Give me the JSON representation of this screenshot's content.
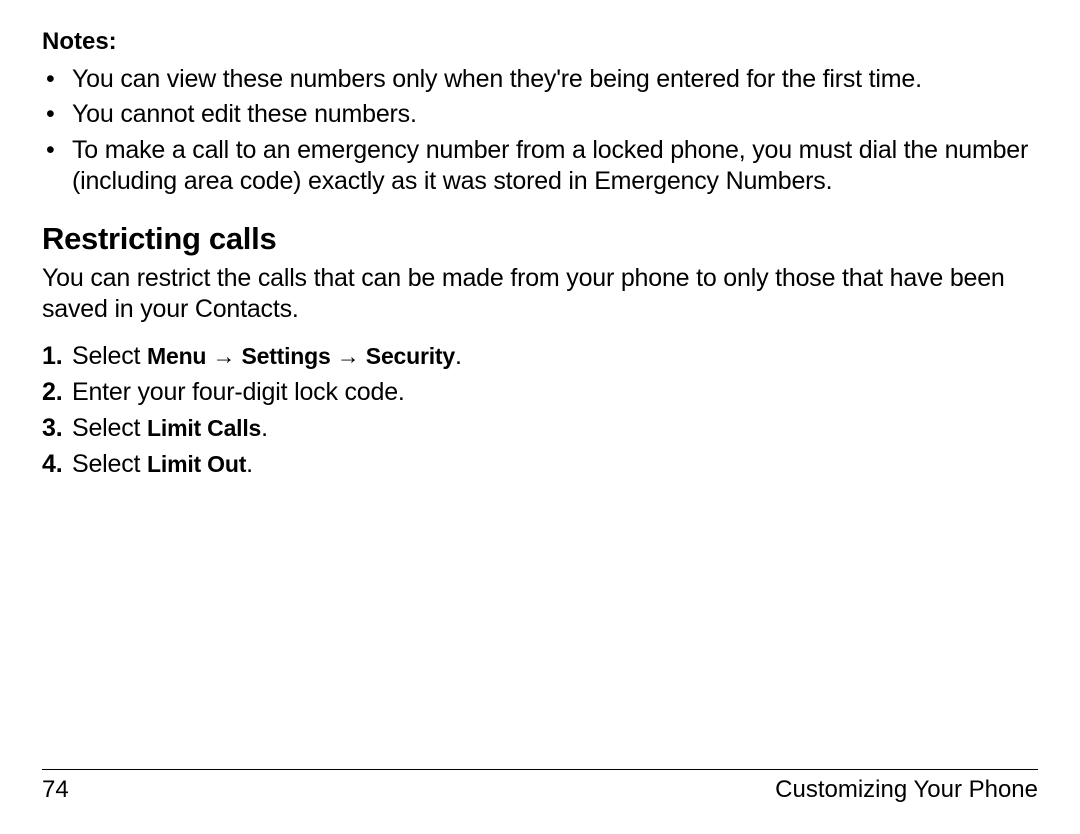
{
  "notes": {
    "heading": "Notes:",
    "items": [
      "You can view these numbers only when they're being entered for the first time.",
      "You cannot edit these numbers.",
      "To make a call to an emergency number from a locked phone, you must dial the number (including area code) exactly as it was stored in Emergency Numbers."
    ]
  },
  "section": {
    "heading": "Restricting calls",
    "intro": "You can restrict the calls that can be made from your phone to only those that have been saved in your Contacts."
  },
  "steps": {
    "step1_num": "1.",
    "step1_prefix": "Select ",
    "step1_menu": "Menu",
    "step1_arrow1": " → ",
    "step1_settings": "Settings",
    "step1_arrow2": " → ",
    "step1_security": "Security",
    "step1_suffix": ".",
    "step2_num": "2.",
    "step2_text": "Enter your four-digit lock code.",
    "step3_num": "3.",
    "step3_prefix": "Select ",
    "step3_bold": "Limit Calls",
    "step3_suffix": ".",
    "step4_num": "4.",
    "step4_prefix": "Select ",
    "step4_bold": "Limit Out",
    "step4_suffix": "."
  },
  "footer": {
    "page": "74",
    "chapter": "Customizing Your Phone"
  }
}
